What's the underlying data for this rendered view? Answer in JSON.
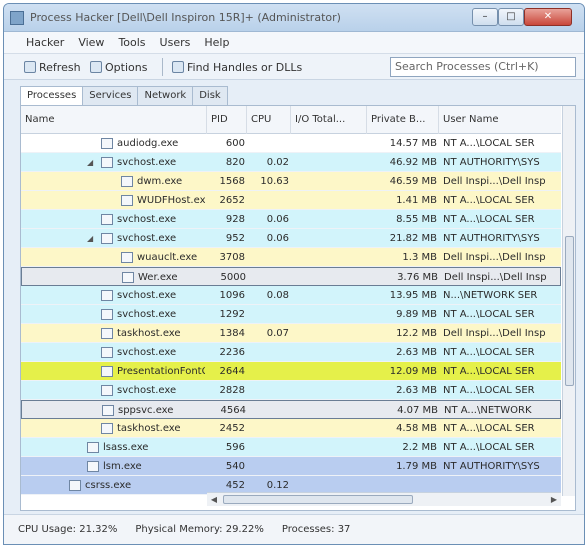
{
  "window": {
    "title": "Process Hacker [Dell\\Dell Inspiron 15R]+ (Administrator)",
    "controls": {
      "minimize": "–",
      "maximize": "□",
      "close": "✕"
    }
  },
  "menu": [
    "Hacker",
    "View",
    "Tools",
    "Users",
    "Help"
  ],
  "toolbar": {
    "refresh": "Refresh",
    "options": "Options",
    "find": "Find Handles or DLLs",
    "search_placeholder": "Search Processes (Ctrl+K)"
  },
  "tabs": [
    "Processes",
    "Services",
    "Network",
    "Disk"
  ],
  "columns": [
    "Name",
    "PID",
    "CPU",
    "I/O Total...",
    "Private B...",
    "User Name"
  ],
  "rows": [
    {
      "name": "audiodg.exe",
      "pid": "600",
      "cpu": "",
      "io": "",
      "priv": "14.57 MB",
      "user": "NT A...\\LOCAL SER"
    },
    {
      "name": "svchost.exe",
      "pid": "820",
      "cpu": "0.02",
      "io": "",
      "priv": "46.92 MB",
      "user": "NT AUTHORITY\\SYS"
    },
    {
      "name": "dwm.exe",
      "pid": "1568",
      "cpu": "10.63",
      "io": "",
      "priv": "46.59 MB",
      "user": "Dell Inspi...\\Dell Insp"
    },
    {
      "name": "WUDFHost.exe",
      "pid": "2652",
      "cpu": "",
      "io": "",
      "priv": "1.41 MB",
      "user": "NT A...\\LOCAL SER"
    },
    {
      "name": "svchost.exe",
      "pid": "928",
      "cpu": "0.06",
      "io": "",
      "priv": "8.55 MB",
      "user": "NT A...\\LOCAL SER"
    },
    {
      "name": "svchost.exe",
      "pid": "952",
      "cpu": "0.06",
      "io": "",
      "priv": "21.82 MB",
      "user": "NT AUTHORITY\\SYS"
    },
    {
      "name": "wuauclt.exe",
      "pid": "3708",
      "cpu": "",
      "io": "",
      "priv": "1.3 MB",
      "user": "Dell Inspi...\\Dell Insp"
    },
    {
      "name": "Wer.exe",
      "pid": "5000",
      "cpu": "",
      "io": "",
      "priv": "3.76 MB",
      "user": "Dell Inspi...\\Dell Insp"
    },
    {
      "name": "svchost.exe",
      "pid": "1096",
      "cpu": "0.08",
      "io": "",
      "priv": "13.95 MB",
      "user": "N...\\NETWORK SER"
    },
    {
      "name": "svchost.exe",
      "pid": "1292",
      "cpu": "",
      "io": "",
      "priv": "9.89 MB",
      "user": "NT A...\\LOCAL SER"
    },
    {
      "name": "taskhost.exe",
      "pid": "1384",
      "cpu": "0.07",
      "io": "",
      "priv": "12.2 MB",
      "user": "Dell Inspi...\\Dell Insp"
    },
    {
      "name": "svchost.exe",
      "pid": "2236",
      "cpu": "",
      "io": "",
      "priv": "2.63 MB",
      "user": "NT A...\\LOCAL SER"
    },
    {
      "name": "PresentationFontC...",
      "pid": "2644",
      "cpu": "",
      "io": "",
      "priv": "12.09 MB",
      "user": "NT A...\\LOCAL SER"
    },
    {
      "name": "svchost.exe",
      "pid": "2828",
      "cpu": "",
      "io": "",
      "priv": "2.63 MB",
      "user": "NT A...\\LOCAL SER"
    },
    {
      "name": "sppsvc.exe",
      "pid": "4564",
      "cpu": "",
      "io": "",
      "priv": "4.07 MB",
      "user": "NT A...\\NETWORK"
    },
    {
      "name": "taskhost.exe",
      "pid": "2452",
      "cpu": "",
      "io": "",
      "priv": "4.58 MB",
      "user": "NT A...\\LOCAL SER"
    },
    {
      "name": "lsass.exe",
      "pid": "596",
      "cpu": "",
      "io": "",
      "priv": "2.2 MB",
      "user": "NT A...\\LOCAL SER"
    },
    {
      "name": "lsm.exe",
      "pid": "540",
      "cpu": "",
      "io": "",
      "priv": "1.79 MB",
      "user": "NT AUTHORITY\\SYS"
    },
    {
      "name": "csrss.exe",
      "pid": "452",
      "cpu": "0.12",
      "io": "",
      "priv": "",
      "user": ""
    }
  ],
  "status": {
    "cpu": "CPU Usage: 21.32%",
    "memory": "Physical Memory: 29.22%",
    "processes": "Processes: 37"
  }
}
